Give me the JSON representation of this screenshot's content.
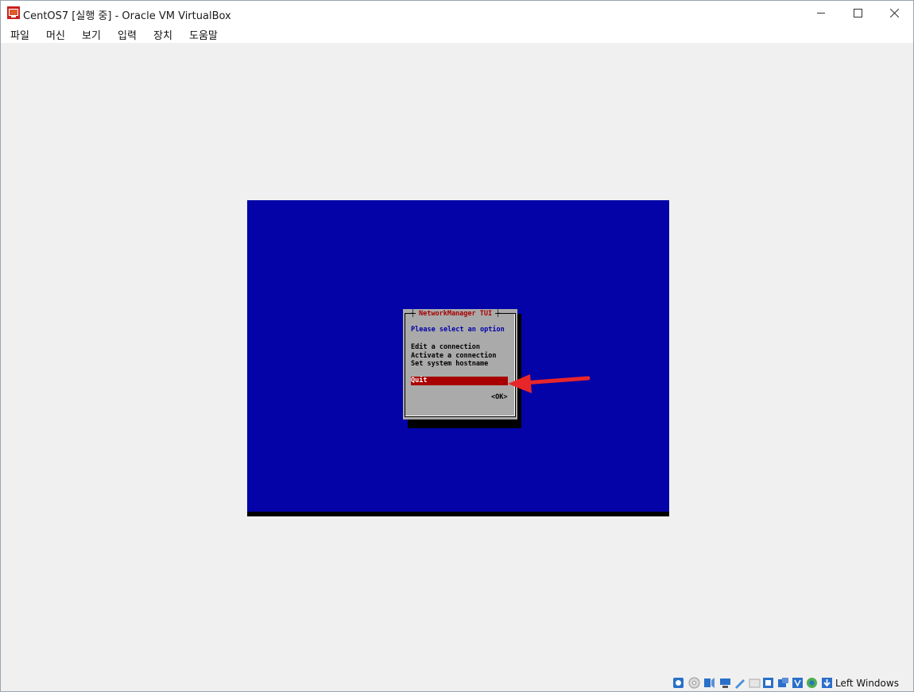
{
  "window": {
    "title": "CentOS7 [실행 중] - Oracle VM VirtualBox",
    "controls": [
      "minimize",
      "maximize",
      "close"
    ]
  },
  "menu": [
    "파일",
    "머신",
    "보기",
    "입력",
    "장치",
    "도움말"
  ],
  "console": {
    "background": "#0303a8",
    "dialog": {
      "title": "NetworkManager TUI",
      "prompt": "Please select an option",
      "options": [
        "Edit a connection",
        "Activate a connection",
        "Set system hostname"
      ],
      "selected": "Quit",
      "ok": "<OK>"
    }
  },
  "annotation": {
    "type": "arrow",
    "color": "#e8262a",
    "points_to": "Quit"
  },
  "statusbar": {
    "icons": [
      "hard-disk-icon",
      "optical-drive-icon",
      "audio-icon",
      "network-icon",
      "usb-icon",
      "shared-folders-icon",
      "display-icon",
      "video-capture-icon",
      "virtualization-icon",
      "mouse-integration-icon",
      "keyboard-capture-icon"
    ],
    "host_key": "Left Windows"
  }
}
